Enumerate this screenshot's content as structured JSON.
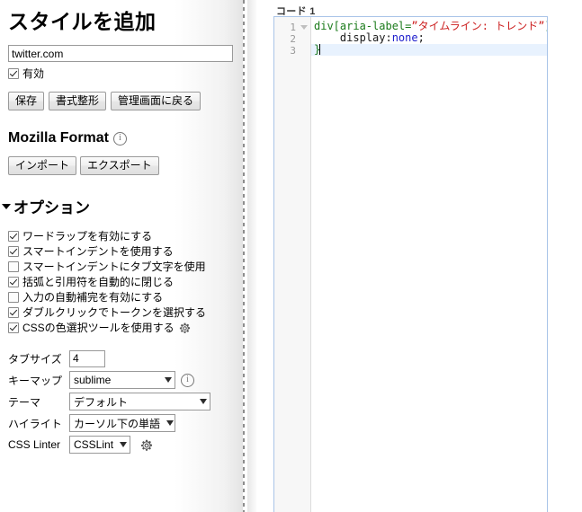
{
  "page": {
    "title": "スタイルを追加"
  },
  "url_field": {
    "value": "twitter.com",
    "placeholder": ""
  },
  "enabled_checkbox": {
    "label": "有効",
    "checked": true
  },
  "actions": {
    "save_label": "保存",
    "beautify_label": "書式整形",
    "back_label": "管理画面に戻る"
  },
  "mozilla": {
    "heading": "Mozilla Format",
    "info_icon": "info-icon",
    "import_label": "インポート",
    "export_label": "エクスポート"
  },
  "options": {
    "heading": "オプション",
    "expander_icon": "chevron-down-icon",
    "items": [
      {
        "label": "ワードラップを有効にする",
        "checked": true,
        "icon": null
      },
      {
        "label": "スマートインデントを使用する",
        "checked": true,
        "icon": null
      },
      {
        "label": "スマートインデントにタブ文字を使用",
        "checked": false,
        "icon": null
      },
      {
        "label": "括弧と引用符を自動的に閉じる",
        "checked": true,
        "icon": null
      },
      {
        "label": "入力の自動補完を有効にする",
        "checked": false,
        "icon": null
      },
      {
        "label": "ダブルクリックでトークンを選択する",
        "checked": true,
        "icon": null
      },
      {
        "label": "CSSの色選択ツールを使用する",
        "checked": true,
        "icon": "gear-icon"
      }
    ]
  },
  "fields": {
    "tab_size": {
      "label": "タブサイズ",
      "value": "4"
    },
    "keymap": {
      "label": "キーマップ",
      "value": "sublime",
      "info_icon": "info-icon"
    },
    "theme": {
      "label": "テーマ",
      "value": "デフォルト"
    },
    "highlight": {
      "label": "ハイライト",
      "value": "カーソル下の単語"
    },
    "css_linter": {
      "label": "CSS Linter",
      "value": "CSSLint",
      "gear_icon": "gear-icon"
    }
  },
  "editor": {
    "section_label": "コード 1",
    "gutter_lines": [
      "1",
      "2",
      "3"
    ],
    "active_line": 3,
    "lines": [
      {
        "num": "1",
        "tokens": [
          {
            "text": "div[aria-label=",
            "type": "selector"
          },
          {
            "text": "”タイムライン: トレンド”",
            "type": "string"
          },
          {
            "text": "] {",
            "type": "brace"
          }
        ]
      },
      {
        "num": "2",
        "tokens": [
          {
            "text": "    display:",
            "type": "property"
          },
          {
            "text": "none",
            "type": "value"
          },
          {
            "text": ";",
            "type": "property"
          }
        ]
      },
      {
        "num": "3",
        "tokens": [
          {
            "text": "}",
            "type": "brace"
          }
        ]
      }
    ],
    "plain_text": "div[aria-label=”タイムライン: トレンド”] {\n    display:none;\n}"
  },
  "colors": {
    "selector": "#1a7a1a",
    "string": "#cc2020",
    "value": "#1a1acc",
    "active_line_bg": "#e8f2fe",
    "editor_border": "#a9c4e8"
  }
}
